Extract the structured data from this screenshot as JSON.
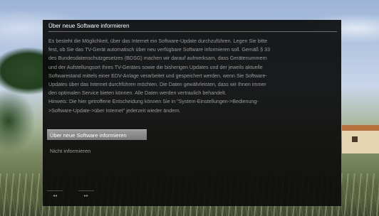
{
  "dialog": {
    "title": "Über neue Software informieren",
    "body_lines": [
      "Es besteht die Möglichkeit, über das Internet ein Software-Update durchzuführen. Legen Sie bitte",
      "fest, ob Sie das TV-Gerät automatisch über neu verfügbare Software informieren soll. Gemäß § 33",
      "des Bundesdatenschutzgesetzes (BDSG) machen wir darauf aufmerksam, dass Gerätenummern",
      "und der Aufstellungsort Ihres TV-Gerätes sowie die bisherigen Updates und der jeweils aktuelle",
      "Softwarestand mittels einer EDV-Anlage verarbeitet und gespeichert werden, wenn Sie Software-",
      "Updates über das Internet durchführen möchten. Die Daten gewährleisten, dass wir Ihnen immer",
      "den optimalen Service bieten können. Alle Daten werden vertraulich behandelt.",
      "Hinweis: Die hier getroffene Entscheidung können Sie in \"System-Einstellungen->Bedienung-",
      ">Software-Update->über Internet\" jederzeit wieder ändern."
    ],
    "option_inform_label": "Über neue Software informieren",
    "option_dont_inform_label": "Nicht informieren",
    "nav_prev_glyph": "◂◂",
    "nav_next_glyph": "▸▸"
  }
}
